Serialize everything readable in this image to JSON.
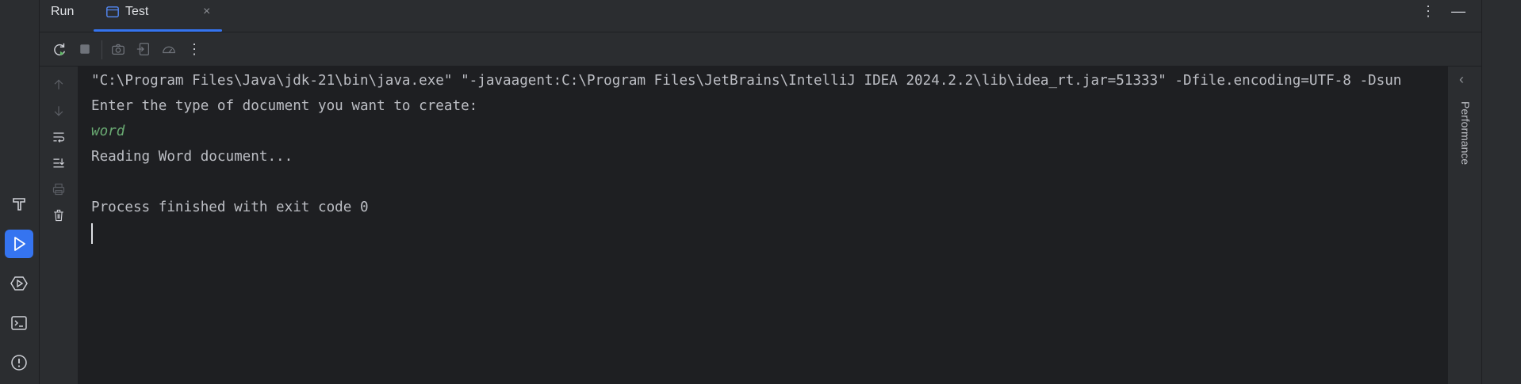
{
  "header": {
    "run_label": "Run",
    "tab_label": "Test",
    "tab_close": "×",
    "more_icon": "⋮",
    "minimize_icon": "—"
  },
  "toolbar": {
    "more_icon": "⋮"
  },
  "console": {
    "lines": [
      "\"C:\\Program Files\\Java\\jdk-21\\bin\\java.exe\" \"-javaagent:C:\\Program Files\\JetBrains\\IntelliJ IDEA 2024.2.2\\lib\\idea_rt.jar=51333\" -Dfile.encoding=UTF-8 -Dsun",
      "Enter the type of document you want to create:",
      "word",
      "Reading Word document...",
      "",
      "Process finished with exit code 0"
    ]
  },
  "right_panel": {
    "label": "Performance",
    "chevron": "‹"
  },
  "colors": {
    "accent": "#3574f0",
    "user_input": "#6aab73",
    "console_bg": "#1e1f22",
    "panel_bg": "#2b2d30"
  }
}
